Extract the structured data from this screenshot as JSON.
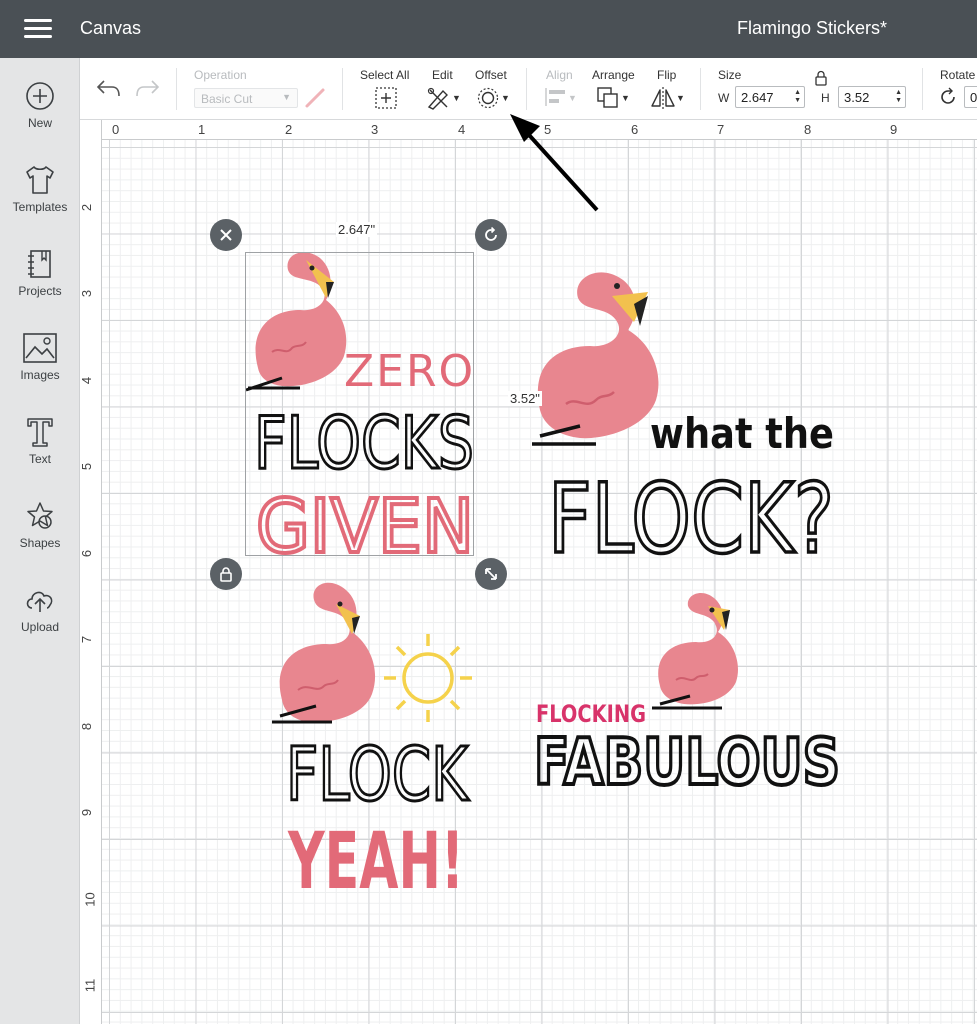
{
  "header": {
    "app_title": "Canvas",
    "project_name": "Flamingo Stickers*"
  },
  "sidebar": {
    "items": [
      {
        "label": "New",
        "icon": "plus-circle-icon"
      },
      {
        "label": "Templates",
        "icon": "tshirt-icon"
      },
      {
        "label": "Projects",
        "icon": "notebook-icon"
      },
      {
        "label": "Images",
        "icon": "image-icon"
      },
      {
        "label": "Text",
        "icon": "text-icon"
      },
      {
        "label": "Shapes",
        "icon": "shapes-icon"
      },
      {
        "label": "Upload",
        "icon": "cloud-upload-icon"
      }
    ]
  },
  "toolbar": {
    "operation_label": "Operation",
    "operation_value": "Basic Cut",
    "select_all_label": "Select All",
    "edit_label": "Edit",
    "offset_label": "Offset",
    "align_label": "Align",
    "arrange_label": "Arrange",
    "flip_label": "Flip",
    "size_label": "Size",
    "width_prefix": "W",
    "width_value": "2.647",
    "height_prefix": "H",
    "height_value": "3.52",
    "rotate_label": "Rotate",
    "rotate_value": "0"
  },
  "ruler": {
    "top": [
      "0",
      "1",
      "2",
      "3",
      "4",
      "5",
      "6",
      "7",
      "8",
      "9"
    ],
    "left": [
      "2",
      "3",
      "4",
      "5",
      "6",
      "7",
      "8",
      "9",
      "10",
      "11"
    ]
  },
  "selection": {
    "width_text": "2.647\"",
    "height_text": "3.52\""
  },
  "designs": {
    "zero_flocks": {
      "line1": "ZERO",
      "line2": "FLOCKS",
      "line3": "GIVEN"
    },
    "what_the_flock": {
      "line1": "what the",
      "line2": "FLOCK?"
    },
    "flock_yeah": {
      "line1": "FLOCK",
      "line2": "YEAH!"
    },
    "flocking_fabulous": {
      "line1": "FLOCKING",
      "line2": "FABULOUS"
    }
  },
  "colors": {
    "topbar": "#4a5055",
    "flamingo": "#e8868f",
    "flamingo_dark": "#d9707a",
    "beak": "#f2c14e",
    "text_pink": "#e26a78",
    "text_magenta": "#d8336a",
    "sun": "#f5d24b"
  }
}
